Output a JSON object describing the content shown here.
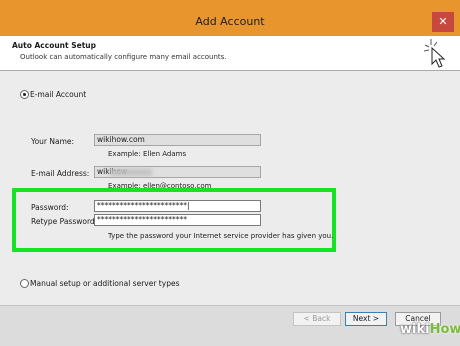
{
  "window": {
    "title": "Add Account",
    "close_symbol": "✕"
  },
  "header": {
    "title": "Auto Account Setup",
    "subtitle": "Outlook can automatically configure many email accounts."
  },
  "email_account": {
    "label": "E-mail Account",
    "selected": true
  },
  "fields": {
    "name": {
      "label": "Your Name:",
      "value": "wikihow.com",
      "example": "Example: Ellen Adams"
    },
    "email": {
      "label": "E-mail Address:",
      "value": "wikihow",
      "example": "Example: ellen@contoso.com"
    },
    "password": {
      "label": "Password:",
      "value": "************************|"
    },
    "retype_password": {
      "label": "Retype Password:",
      "value": "************************"
    },
    "password_hint": "Type the password your Internet service provider has given you."
  },
  "manual_setup": {
    "label": "Manual setup or additional server types",
    "selected": false
  },
  "buttons": {
    "back": "< Back",
    "next": "Next >",
    "cancel": "Cancel"
  },
  "watermark": {
    "prefix": "wiki",
    "suffix": "How"
  },
  "colors": {
    "titlebar": "#e9952d",
    "highlight": "#17e325",
    "close": "#c7483e"
  }
}
